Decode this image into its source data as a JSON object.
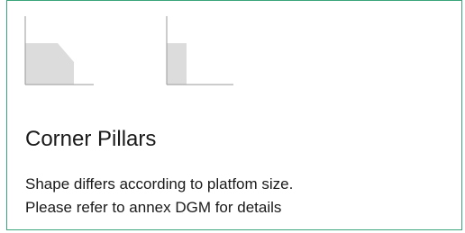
{
  "card": {
    "title": "Corner Pillars",
    "description_lines": [
      "Shape differs according to platfom size.",
      "Please refer to annex DGM for details"
    ]
  },
  "icons": [
    {
      "name": "chamfered-corner-pillar-icon"
    },
    {
      "name": "square-corner-pillar-icon"
    }
  ],
  "colors": {
    "border": "#3aa57a",
    "shape_fill": "#dcdcdc",
    "line": "#9a9a9a",
    "text": "#1a1a1a"
  }
}
